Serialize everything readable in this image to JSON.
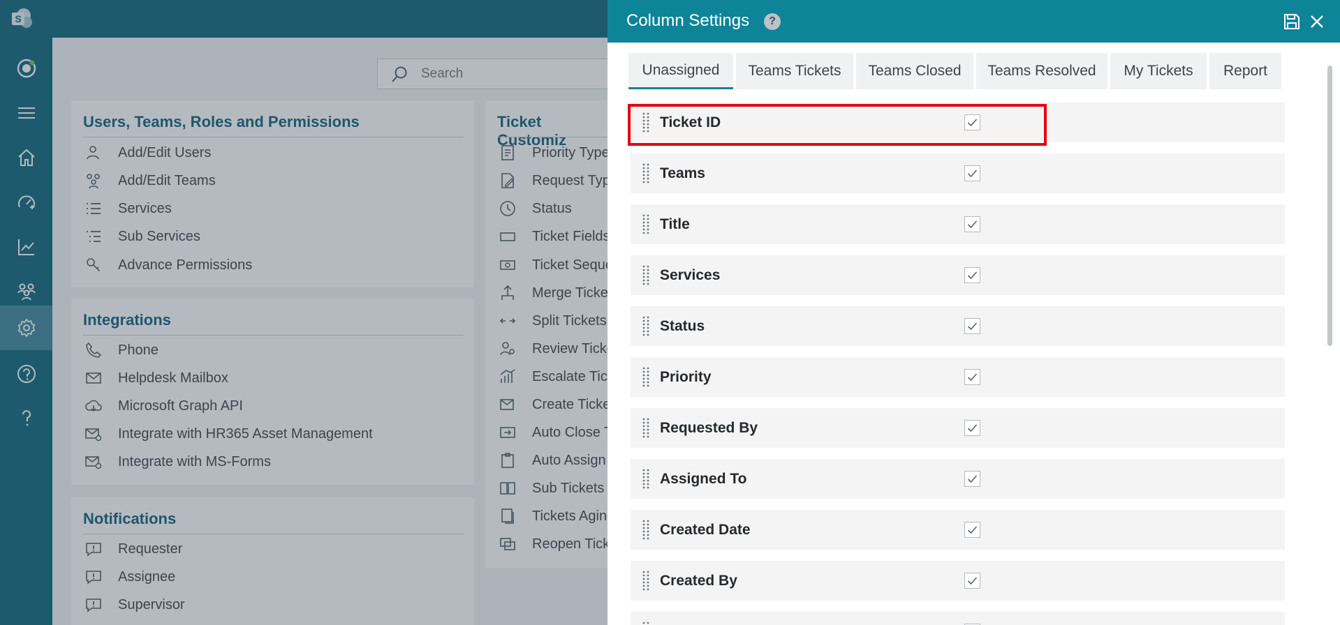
{
  "colors": {
    "rail": "#0c6579",
    "panel_header": "#0e8499",
    "section_title": "#0c5f75",
    "highlight": "#e30613"
  },
  "rail": {
    "icons": [
      "sharepoint-logo",
      "sphere-icon",
      "menu-icon",
      "home-icon",
      "dashboard-icon",
      "analytics-icon",
      "teams-icon",
      "settings-icon",
      "help-circle-icon",
      "question-icon"
    ],
    "active": "settings-icon"
  },
  "search": {
    "placeholder": "Search"
  },
  "sections": {
    "users": {
      "title": "Users, Teams, Roles and Permissions",
      "items": [
        {
          "label": "Add/Edit Users",
          "icon": "user-icon"
        },
        {
          "label": "Add/Edit Teams",
          "icon": "team-icon"
        },
        {
          "label": "Services",
          "icon": "list-icon"
        },
        {
          "label": "Sub Services",
          "icon": "sub-list-icon"
        },
        {
          "label": "Advance Permissions",
          "icon": "key-icon"
        }
      ]
    },
    "integrations": {
      "title": "Integrations",
      "items": [
        {
          "label": "Phone",
          "icon": "phone-icon"
        },
        {
          "label": "Helpdesk Mailbox",
          "icon": "mail-icon"
        },
        {
          "label": "Microsoft Graph API",
          "icon": "cloud-icon"
        },
        {
          "label": "Integrate with HR365 Asset Management",
          "icon": "mail-settings-icon"
        },
        {
          "label": "Integrate with MS-Forms",
          "icon": "mail-settings-icon"
        }
      ]
    },
    "notifications": {
      "title": "Notifications",
      "items": [
        {
          "label": "Requester",
          "icon": "alert-bubble-icon"
        },
        {
          "label": "Assignee",
          "icon": "alert-bubble-icon"
        },
        {
          "label": "Supervisor",
          "icon": "alert-bubble-icon"
        }
      ]
    },
    "ticket": {
      "title": "Ticket Customiz",
      "items": [
        {
          "label": "Priority Type",
          "icon": "priority-icon"
        },
        {
          "label": "Request Typ",
          "icon": "edit-icon"
        },
        {
          "label": "Status",
          "icon": "clock-icon"
        },
        {
          "label": "Ticket Fields",
          "icon": "field-icon"
        },
        {
          "label": "Ticket Seque",
          "icon": "sequence-icon"
        },
        {
          "label": "Merge Ticke",
          "icon": "merge-icon"
        },
        {
          "label": "Split Tickets",
          "icon": "split-icon"
        },
        {
          "label": "Review Ticke",
          "icon": "review-icon"
        },
        {
          "label": "Escalate Tick",
          "icon": "escalate-icon"
        },
        {
          "label": "Create Ticke",
          "icon": "create-icon"
        },
        {
          "label": "Auto Close T",
          "icon": "auto-close-icon"
        },
        {
          "label": "Auto Assign",
          "icon": "auto-assign-icon"
        },
        {
          "label": "Sub Tickets",
          "icon": "sub-tickets-icon"
        },
        {
          "label": "Tickets Agin",
          "icon": "aging-icon"
        },
        {
          "label": "Reopen Tick",
          "icon": "reopen-icon"
        }
      ]
    }
  },
  "panel": {
    "title": "Column Settings",
    "help": "?",
    "tabs": [
      {
        "label": "Unassigned",
        "active": true
      },
      {
        "label": "Teams Tickets",
        "active": false
      },
      {
        "label": "Teams Closed",
        "active": false
      },
      {
        "label": "Teams Resolved",
        "active": false
      },
      {
        "label": "My Tickets",
        "active": false
      },
      {
        "label": "Report",
        "active": false
      }
    ],
    "columns": [
      {
        "label": "Ticket ID",
        "checked": true,
        "highlighted": true
      },
      {
        "label": "Teams",
        "checked": true
      },
      {
        "label": "Title",
        "checked": true
      },
      {
        "label": "Services",
        "checked": true
      },
      {
        "label": "Status",
        "checked": true
      },
      {
        "label": "Priority",
        "checked": true
      },
      {
        "label": "Requested By",
        "checked": true
      },
      {
        "label": "Assigned To",
        "checked": true
      },
      {
        "label": "Created Date",
        "checked": true
      },
      {
        "label": "Created By",
        "checked": true
      },
      {
        "label": "",
        "checked": true
      }
    ]
  }
}
